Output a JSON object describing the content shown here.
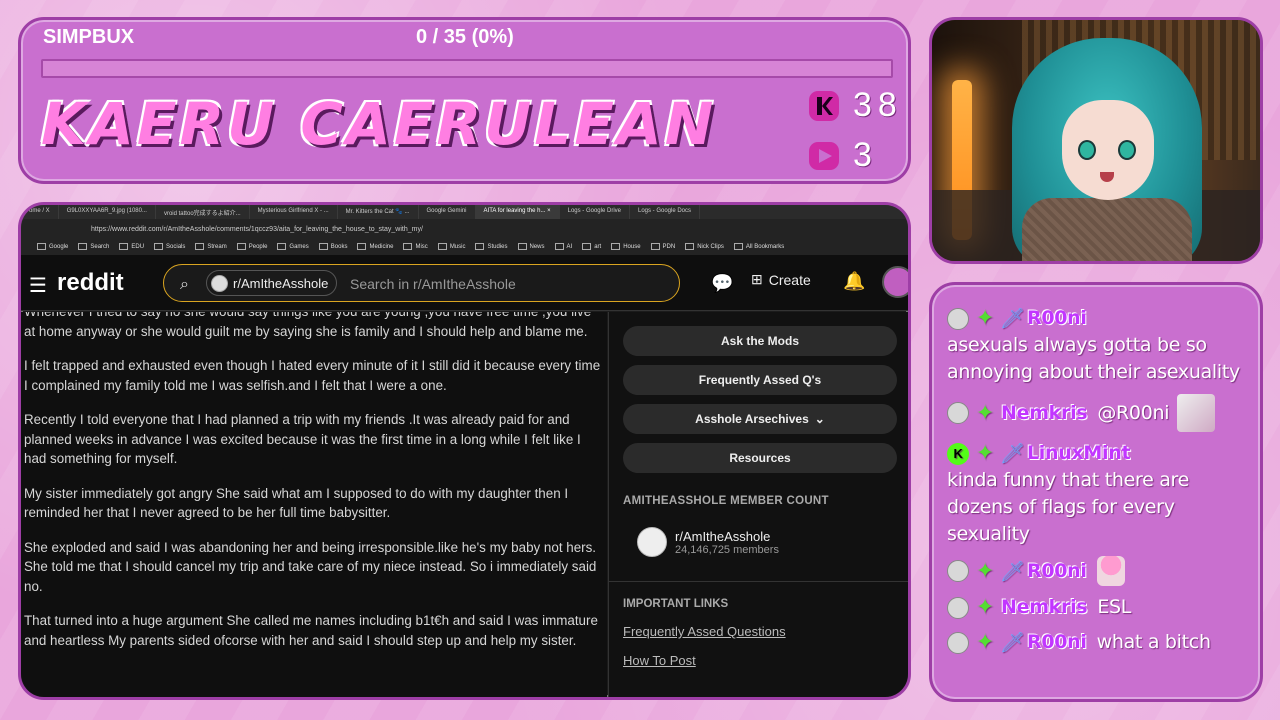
{
  "overlay": {
    "simpbux_label": "SIMPBUX",
    "simpbux_count": "0 / 35 (0%)",
    "simpbux_progress": 0,
    "streamer_name": "KAERU CAERULEAN",
    "kick_followers": "38",
    "twitch_followers": "3",
    "colors": {
      "accent": "#ff4fc8",
      "panel": "#c96fcf",
      "border": "#9e3ea6"
    }
  },
  "browser": {
    "tabs": [
      {
        "label": "ome / X"
      },
      {
        "label": "G9L0XXYAA6R_9.jpg (1080..."
      },
      {
        "label": "vroid tattoo完成するよ紹介..."
      },
      {
        "label": "Mysterious Girlfriend X - ..."
      },
      {
        "label": "Mr. Kitters the Cat 🐾 ..."
      },
      {
        "label": "Google Gemini"
      },
      {
        "label": "AITA for leaving the h... ×"
      },
      {
        "label": "Logs - Google Drive"
      },
      {
        "label": "Logs - Google Docs"
      }
    ],
    "url": "https://www.reddit.com/r/AmItheAsshole/comments/1qccz93/aita_for_leaving_the_house_to_stay_with_my/",
    "bookmarks": [
      "Google",
      "Search",
      "EDU",
      "Socials",
      "Stream",
      "People",
      "Games",
      "Books",
      "Medicine",
      "Misc",
      "Music",
      "Studies",
      "News",
      "AI",
      "art",
      "House",
      "PDN",
      "Nick Clips",
      "All Bookmarks"
    ]
  },
  "reddit": {
    "logo": "reddit",
    "subreddit": "r/AmItheAsshole",
    "search_placeholder": "Search in r/AmItheAsshole",
    "create_label": "Create",
    "post_paragraphs": [
      "Whenever I tried to say no she would say things like you are young ,you have free time ,you live at home anyway or she would guilt me by saying she is family and I should help and blame me.",
      "I felt trapped and exhausted even though I hated every minute of it I still did it because every time I complained my family told me I was selfish.and I felt that I were a one.",
      "Recently I told everyone that I had planned a trip with my friends .It was already paid for and planned weeks in advance I was excited because it was the first time in a long while I felt like I had something for myself.",
      "My sister immediately got angry She said what am I supposed to do with my daughter then I reminded her that I never agreed to be her full time babysitter.",
      "She exploded and said I was abandoning her and being irresponsible.like he's my baby not hers. She told me that I should cancel my trip and take care of my niece instead. So i immediately said no.",
      "That turned into a huge argument She called me names including b1t€h and said I was immature and heartless My parents sided ofcorse with her and said I should step up and help my sister."
    ],
    "sidebar": {
      "buttons": [
        "Ask the Mods",
        "Frequently Assed Q's",
        "Asshole Arsechives",
        "Resources"
      ],
      "member_heading": "AMITHEASSHOLE MEMBER COUNT",
      "member_sub": "r/AmItheAsshole",
      "member_count": "24,146,725 members",
      "important_heading": "IMPORTANT LINKS",
      "links": [
        "Frequently Assed Questions",
        "How To Post"
      ]
    }
  },
  "chat": {
    "messages": [
      {
        "user": "R00ni",
        "text": "asexuals always gotta be so annoying about their asexuality"
      },
      {
        "user": "Nemkris",
        "text": "@R00ni"
      },
      {
        "user": "LinuxMint",
        "text": "kinda funny that there are dozens of flags for every sexuality"
      },
      {
        "user": "R00ni",
        "text": ""
      },
      {
        "user": "Nemkris",
        "text": "ESL"
      },
      {
        "user": "R00ni",
        "text": "what a bitch"
      }
    ]
  }
}
